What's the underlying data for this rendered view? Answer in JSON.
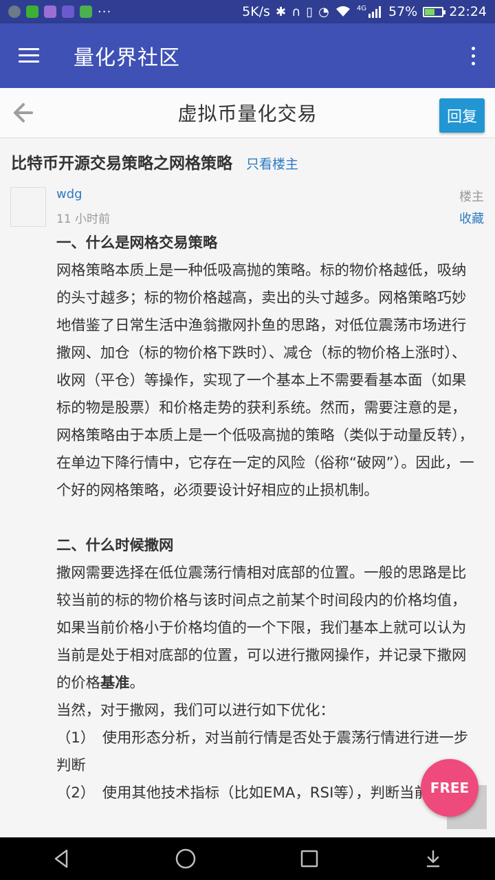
{
  "status_bar": {
    "net_speed": "5K/s",
    "signal_label": "4G",
    "battery_percent": "57%",
    "battery_level": 0.57,
    "time": "22:24",
    "more": "···"
  },
  "app_bar": {
    "title": "量化界社区"
  },
  "sub_header": {
    "title": "虚拟币量化交易",
    "reply_label": "回复"
  },
  "post": {
    "title": "比特币开源交易策略之网格策略",
    "only_op_label": "只看楼主",
    "author": "wdg",
    "time": "11 小时前",
    "op_label": "楼主",
    "favorite_label": "收藏",
    "heading1": "一、什么是网格交易策略",
    "para1": "网格策略本质上是一种低吸高抛的策略。标的物价格越低，吸纳的头寸越多；标的物价格越高，卖出的头寸越多。网格策略巧妙地借鉴了日常生活中渔翁撒网扑鱼的思路，对低位震荡市场进行撒网、加仓（标的物价格下跌时）、减仓（标的物价格上涨时）、收网（平仓）等操作，实现了一个基本上不需要看基本面（如果标的物是股票）和价格走势的获利系统。然而，需要注意的是，网格策略由于本质上是一个低吸高抛的策略（类似于动量反转），在单边下降行情中，它存在一定的风险（俗称“破网”）。因此，一个好的网格策略，必须要设计好相应的止损机制。",
    "heading2": "二、什么时候撒网",
    "para2_main": "撒网需要选择在低位震荡行情相对底部的位置。一般的思路是比较当前的标的物价格与该时间点之前某个时间段内的价格均值，如果当前价格小于价格均值的一个下限，我们基本上就可以认为当前是处于相对底部的位置，可以进行撒网操作，并记录下撒网的价格",
    "para2_bold": "基准",
    "para2_end": "。",
    "para3": "当然，对于撒网，我们可以进行如下优化：",
    "item1": "（1）　使用形态分析，对当前行情是否处于震荡行情进行进一步判断",
    "item2": "（2）　使用其他技术指标（比如EMA，RSI等），判断当前是"
  },
  "free_badge": "FREE",
  "colors": {
    "status_bar": "#2f3e93",
    "app_bar": "#3f51b5",
    "reply_button": "#2196d3",
    "link": "#2a7ac3",
    "free_badge": "#ee4a7c"
  }
}
